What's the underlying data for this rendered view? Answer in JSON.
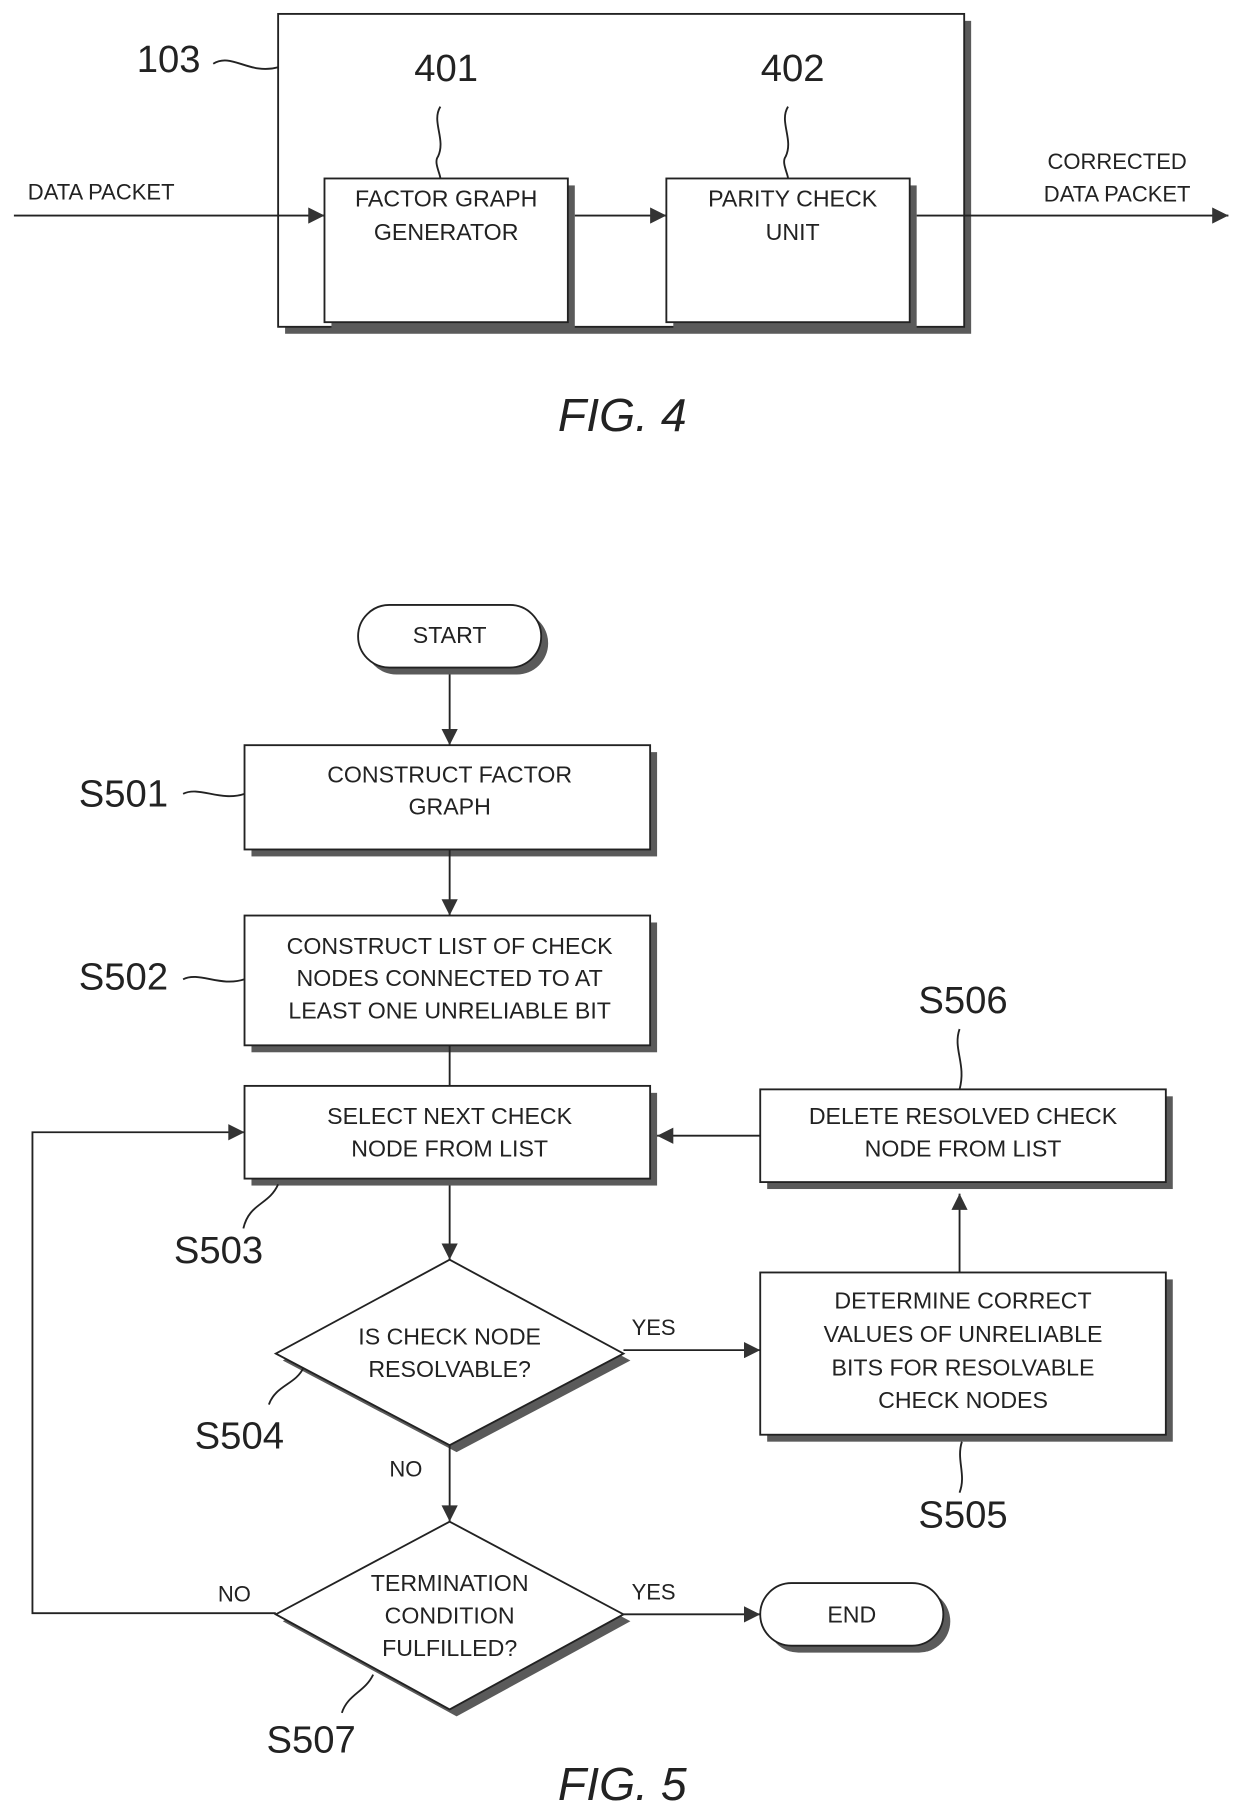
{
  "fig4": {
    "caption": "FIG. 4",
    "container_ref": "103",
    "input_label": "DATA PACKET",
    "output_label": [
      "CORRECTED",
      "DATA PACKET"
    ],
    "blocks": [
      {
        "ref": "401",
        "lines": [
          "FACTOR GRAPH",
          "GENERATOR"
        ]
      },
      {
        "ref": "402",
        "lines": [
          "PARITY CHECK",
          "UNIT"
        ]
      }
    ]
  },
  "fig5": {
    "caption": "FIG. 5",
    "start": "START",
    "end": "END",
    "steps": {
      "s501": {
        "ref": "S501",
        "lines": [
          "CONSTRUCT FACTOR",
          "GRAPH"
        ]
      },
      "s502": {
        "ref": "S502",
        "lines": [
          "CONSTRUCT LIST OF CHECK",
          "NODES CONNECTED TO AT",
          "LEAST ONE UNRELIABLE BIT"
        ]
      },
      "s503": {
        "ref": "S503",
        "lines": [
          "SELECT NEXT CHECK",
          "NODE FROM LIST"
        ]
      },
      "s504": {
        "ref": "S504",
        "lines": [
          "IS CHECK NODE",
          "RESOLVABLE?"
        ]
      },
      "s505": {
        "ref": "S505",
        "lines": [
          "DETERMINE CORRECT",
          "VALUES OF UNRELIABLE",
          "BITS FOR RESOLVABLE",
          "CHECK NODES"
        ]
      },
      "s506": {
        "ref": "S506",
        "lines": [
          "DELETE RESOLVED CHECK",
          "NODE FROM LIST"
        ]
      },
      "s507": {
        "ref": "S507",
        "lines": [
          "TERMINATION",
          "CONDITION",
          "FULFILLED?"
        ]
      }
    },
    "branch_labels": {
      "s504_yes": "YES",
      "s504_no": "NO",
      "s507_yes": "YES",
      "s507_no": "NO"
    }
  }
}
